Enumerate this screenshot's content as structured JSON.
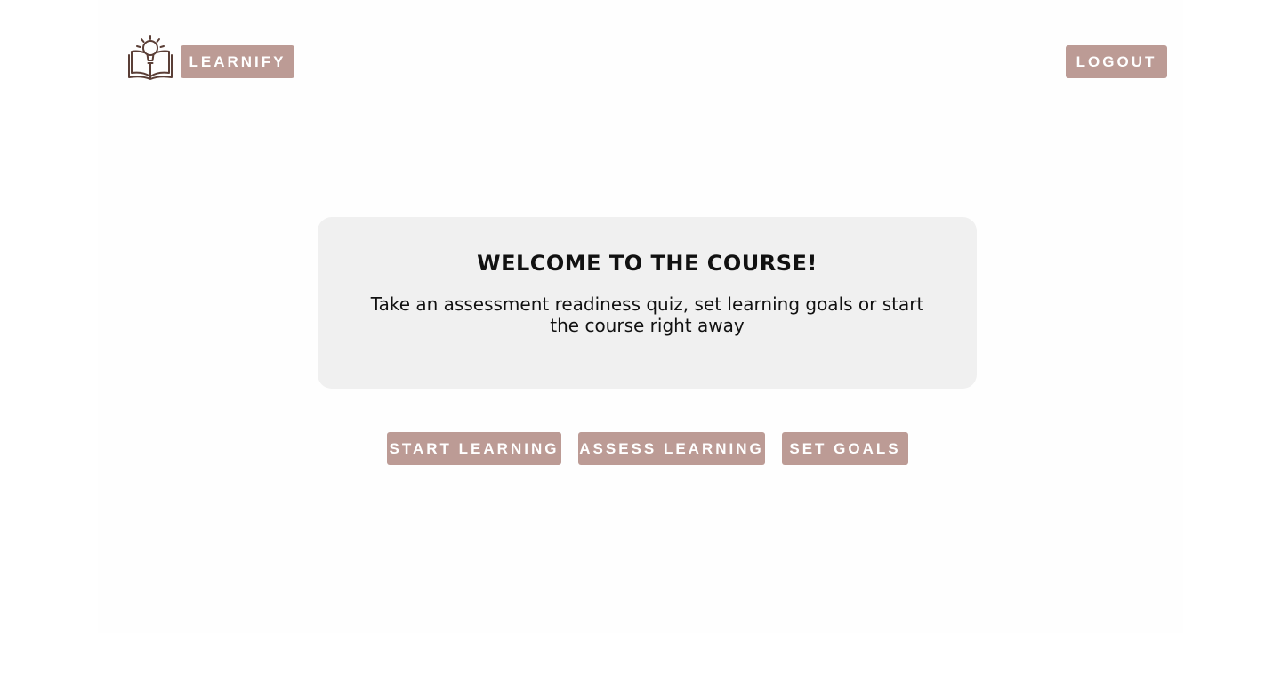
{
  "header": {
    "brand_label": "LEARNIFY",
    "logout_label": "LOGOUT",
    "logo_icon": "book-lightbulb-icon"
  },
  "welcome": {
    "title": "WELCOME TO THE COURSE!",
    "subtitle": "Take an assessment readiness quiz, set learning goals or start the course right away"
  },
  "actions": {
    "start_label": "START LEARNING",
    "assess_label": "ASSESS LEARNING",
    "goals_label": "SET GOALS"
  },
  "colors": {
    "accent": "#bc9b95",
    "card_bg": "#f0f0f0",
    "logo": "#5a3e36"
  }
}
